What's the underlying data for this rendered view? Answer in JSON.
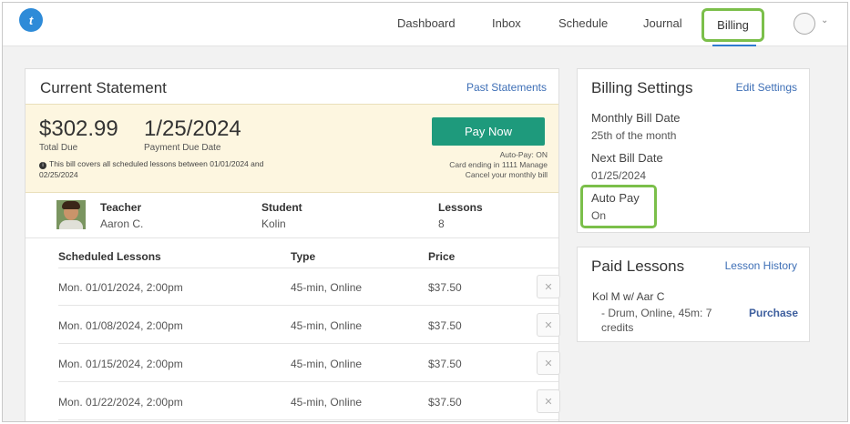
{
  "header": {
    "logo_text": "t",
    "nav": [
      "Dashboard",
      "Inbox",
      "Schedule",
      "Journal",
      "Billing"
    ],
    "active_nav": "Billing"
  },
  "statement": {
    "title": "Current Statement",
    "past_link": "Past Statements",
    "total": "$302.99",
    "total_label": "Total Due",
    "due_date": "1/25/2024",
    "due_date_label": "Payment Due Date",
    "note": "This bill covers all scheduled lessons between 01/01/2024 and 02/25/2024",
    "pay_button": "Pay Now",
    "autopay_line": "Auto-Pay: ON",
    "card_line": "Card ending in 1111 Manage",
    "cancel_line": "Cancel your monthly bill",
    "teacher_head": "Teacher",
    "teacher": "Aaron C.",
    "student_head": "Student",
    "student": "Kolin",
    "lessons_head": "Lessons",
    "lessons": "8",
    "table_headers": [
      "Scheduled Lessons",
      "Type",
      "Price"
    ],
    "rows": [
      {
        "date": "Mon. 01/01/2024, 2:00pm",
        "type": "45-min, Online",
        "price": "$37.50"
      },
      {
        "date": "Mon. 01/08/2024, 2:00pm",
        "type": "45-min, Online",
        "price": "$37.50"
      },
      {
        "date": "Mon. 01/15/2024, 2:00pm",
        "type": "45-min, Online",
        "price": "$37.50"
      },
      {
        "date": "Mon. 01/22/2024, 2:00pm",
        "type": "45-min, Online",
        "price": "$37.50"
      }
    ]
  },
  "settings": {
    "title": "Billing Settings",
    "edit_link": "Edit Settings",
    "monthly_label": "Monthly Bill Date",
    "monthly_value": "25th of the month",
    "next_label": "Next Bill Date",
    "next_value": "01/25/2024",
    "autopay_label": "Auto Pay",
    "autopay_value": "On"
  },
  "paid": {
    "title": "Paid Lessons",
    "history_link": "Lesson History",
    "item_title": "Kol M w/ Aar C",
    "item_detail": "- Drum, Online, 45m: 7 credits",
    "purchase": "Purchase"
  },
  "colors": {
    "accent_green": "#7bbf4a",
    "pay_button": "#1e9a7c",
    "link_blue": "#3e6fb6",
    "due_bg": "#fdf6e0"
  }
}
